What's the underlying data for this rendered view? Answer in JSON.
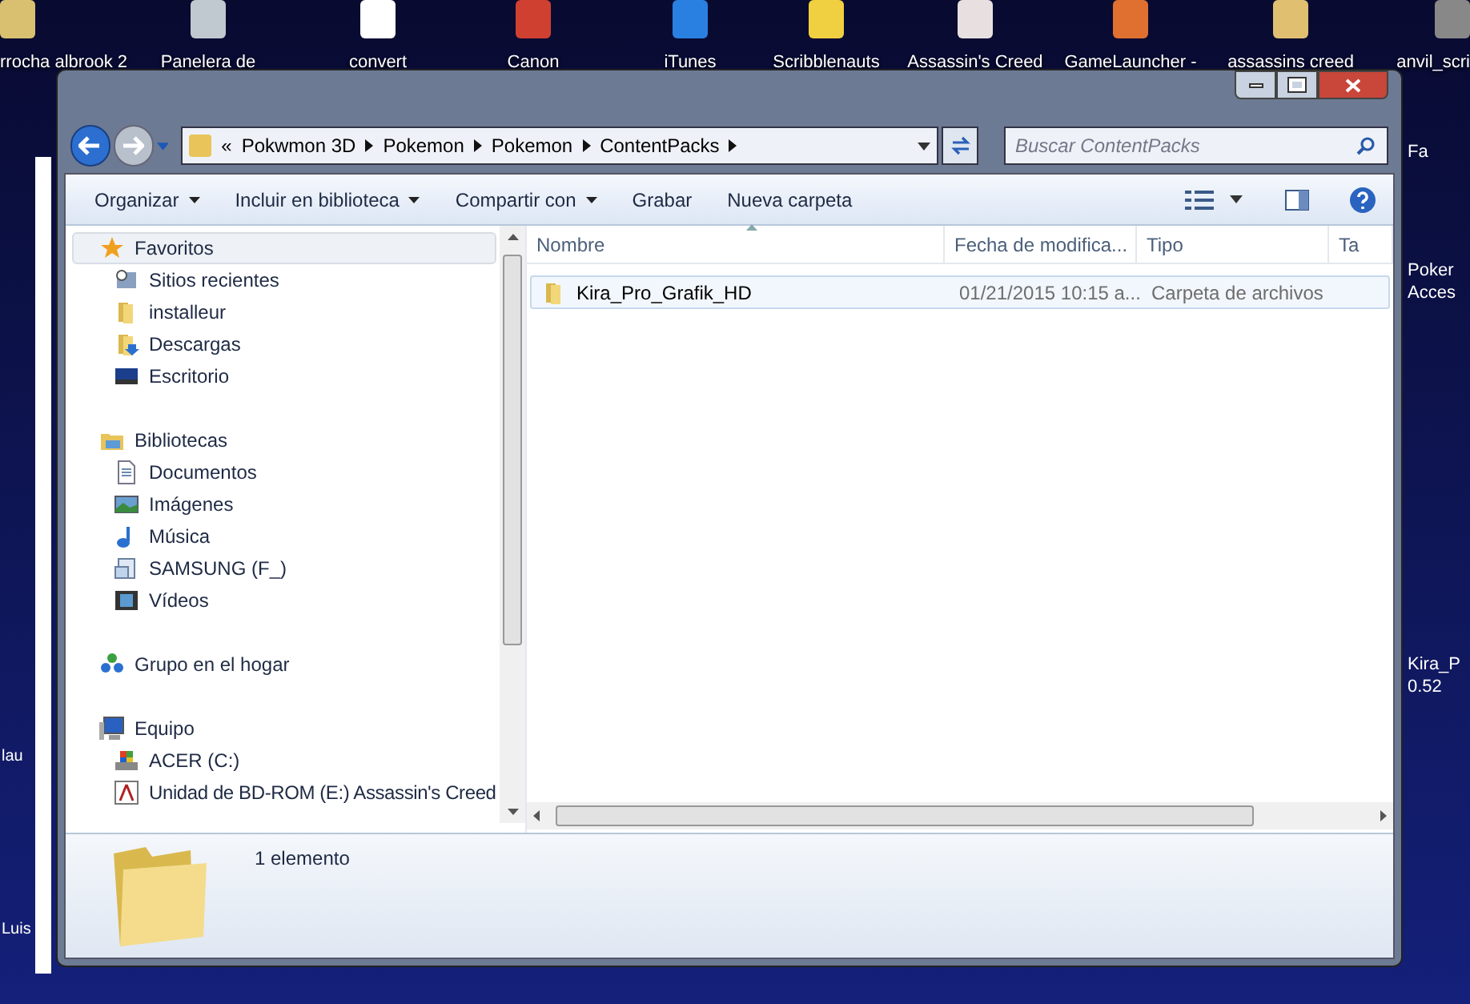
{
  "desktop": {
    "top_icons": [
      {
        "label": "rrocha albrook 2"
      },
      {
        "label": "Panelera de"
      },
      {
        "label": "convert"
      },
      {
        "label": "Canon"
      },
      {
        "label": "iTunes"
      },
      {
        "label": "Scribblenauts"
      },
      {
        "label": "Assassin's Creed"
      },
      {
        "label": "GameLauncher -"
      },
      {
        "label": "assassins creed"
      },
      {
        "label": "anvil_scri"
      }
    ],
    "right_labels": [
      "Fa",
      "Poker",
      "Acces",
      "Kira_P",
      "0.52"
    ],
    "left_labels": [
      "lau",
      "Luis"
    ]
  },
  "address_bar": {
    "overflow": "«",
    "crumbs": [
      "Pokwmon 3D",
      "Pokemon",
      "Pokemon",
      "ContentPacks"
    ]
  },
  "search": {
    "placeholder": "Buscar ContentPacks"
  },
  "toolbar": [
    {
      "label": "Organizar",
      "dropdown": true
    },
    {
      "label": "Incluir en biblioteca",
      "dropdown": true
    },
    {
      "label": "Compartir con",
      "dropdown": true
    },
    {
      "label": "Grabar",
      "dropdown": false
    },
    {
      "label": "Nueva carpeta",
      "dropdown": false
    }
  ],
  "nav_groups": [
    {
      "label": "Favoritos",
      "selected": true,
      "children": [
        {
          "label": "Sitios recientes"
        },
        {
          "label": "installeur"
        },
        {
          "label": "Descargas"
        },
        {
          "label": "Escritorio"
        }
      ]
    },
    {
      "label": "Bibliotecas",
      "selected": false,
      "children": [
        {
          "label": "Documentos"
        },
        {
          "label": "Imágenes"
        },
        {
          "label": "Música"
        },
        {
          "label": "SAMSUNG (F_)"
        },
        {
          "label": "Vídeos"
        }
      ]
    },
    {
      "label": "Grupo en el hogar",
      "selected": false
    },
    {
      "label": "Equipo",
      "selected": false,
      "children": [
        {
          "label": "ACER (C:)"
        },
        {
          "label": "Unidad de BD-ROM (E:) Assassin's Creed"
        }
      ]
    }
  ],
  "table": {
    "columns": [
      "Nombre",
      "Fecha de modifica...",
      "Tipo",
      "Ta"
    ],
    "rows": [
      {
        "cells": [
          "Kira_Pro_Grafik_HD",
          "01/21/2015 10:15 a...",
          "Carpeta de archivos"
        ],
        "selected": true
      }
    ]
  },
  "details": {
    "count": "1 elemento"
  }
}
